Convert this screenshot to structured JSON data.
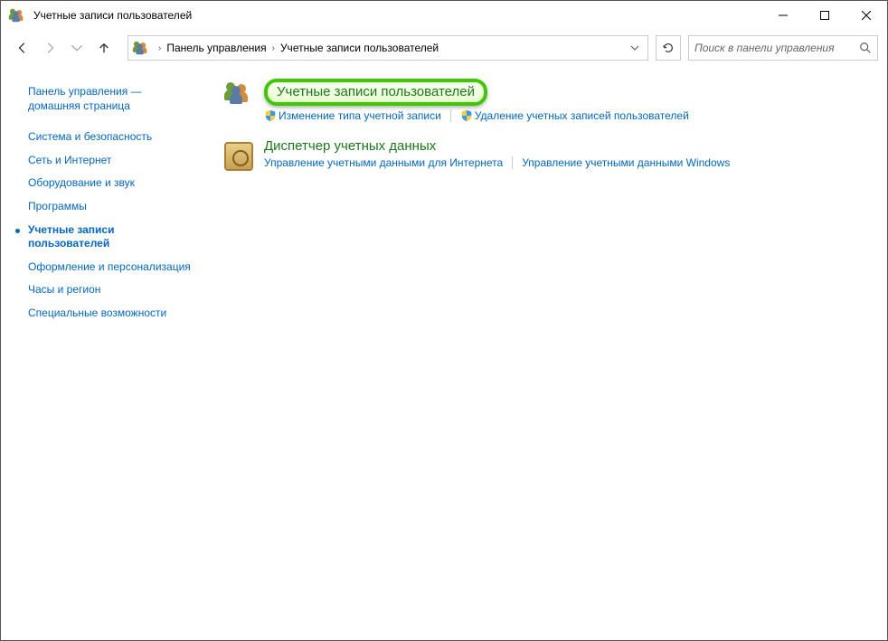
{
  "titlebar": {
    "title": "Учетные записи пользователей"
  },
  "addressbar": {
    "part1": "Панель управления",
    "part2": "Учетные записи пользователей"
  },
  "search": {
    "placeholder": "Поиск в панели управления"
  },
  "sidebar": {
    "home": "Панель управления — домашняя страница",
    "items": [
      {
        "label": "Система и безопасность"
      },
      {
        "label": "Сеть и Интернет"
      },
      {
        "label": "Оборудование и звук"
      },
      {
        "label": "Программы"
      },
      {
        "label": "Учетные записи пользователей",
        "active": true
      },
      {
        "label": "Оформление и персонализация"
      },
      {
        "label": "Часы и регион"
      },
      {
        "label": "Специальные возможности"
      }
    ]
  },
  "main": {
    "section1": {
      "title": "Учетные записи пользователей",
      "link1": "Изменение типа учетной записи",
      "link2": "Удаление учетных записей пользователей"
    },
    "section2": {
      "title": "Диспетчер учетных данных",
      "link1": "Управление учетными данными для Интернета",
      "link2": "Управление учетными данными Windows"
    }
  }
}
